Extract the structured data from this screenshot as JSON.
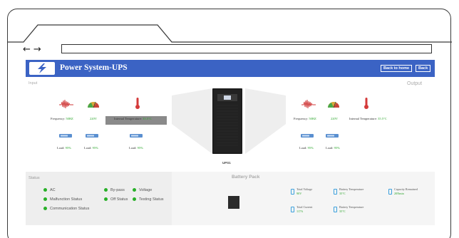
{
  "browser": {
    "back_glyph": "←",
    "forward_glyph": "→"
  },
  "header": {
    "title": "Power System-UPS",
    "back_home_label": "Back to home",
    "back_label": "Back",
    "color": "#3b63c4"
  },
  "input": {
    "label": "Input",
    "frequency": {
      "label": "Frequency:",
      "value": "50HZ"
    },
    "voltage": {
      "value": "220V"
    },
    "internal_temperature": {
      "label": "Internal Temperature:",
      "value": "35.5°C"
    },
    "loads": [
      {
        "label": "Load:",
        "value": "95%"
      },
      {
        "label": "Load:",
        "value": "95%"
      },
      {
        "label": "Load:",
        "value": "95%"
      }
    ]
  },
  "output": {
    "label": "Output",
    "frequency": {
      "label": "Frequency:",
      "value": "50HZ"
    },
    "voltage": {
      "value": "220V"
    },
    "internal_temperature": {
      "label": "Internal Temperature:",
      "value": "35.5°C"
    },
    "loads": [
      {
        "label": "Load:",
        "value": "95%"
      },
      {
        "label": "Load:",
        "value": "95%"
      }
    ]
  },
  "ups": {
    "name": "UPS1"
  },
  "status": {
    "label": "Status",
    "items": [
      {
        "label": "AC"
      },
      {
        "label": "By-pass"
      },
      {
        "label": "Voltage"
      },
      {
        "label": "Malfunction Status"
      },
      {
        "label": "Off Status"
      },
      {
        "label": "Testing Status"
      },
      {
        "label": "Communication Status"
      }
    ],
    "ok_color": "#28b028"
  },
  "battery": {
    "title": "Battery Pack",
    "total_voltage": {
      "label": "Total Voltage",
      "value": "90V"
    },
    "battery_temperature_1": {
      "label": "Battery Temperature",
      "value": "35°C"
    },
    "capacity_remained": {
      "label": "Capacity Remained",
      "value": "20Nmin"
    },
    "total_current": {
      "label": "Total Current",
      "value": "117A"
    },
    "battery_temperature_2": {
      "label": "Battery Temperature",
      "value": "35°C"
    }
  }
}
